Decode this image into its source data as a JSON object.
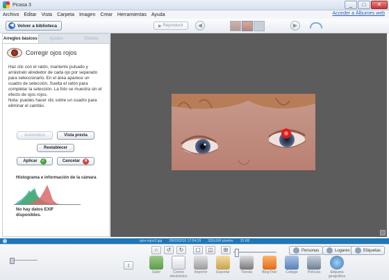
{
  "window": {
    "title": "Picasa 3",
    "controls": [
      "_",
      "□",
      "✕"
    ]
  },
  "menu": {
    "items": [
      "Archivo",
      "Editar",
      "Vista",
      "Carpeta",
      "Imagen",
      "Crear",
      "Herramientas",
      "Ayuda"
    ],
    "sign_in": "Acceder a Álbumes web"
  },
  "toolbar": {
    "back_label": "Volver a biblioteca",
    "play_label": "Reproducir"
  },
  "edit_panel": {
    "tabs": [
      "Arreglos básicos",
      "Ajustes",
      "Efectos"
    ],
    "tool_title": "Corregir ojos rojos",
    "instructions": "Haz clic con el ratón, mantenlo pulsado y arrástralo alrededor de cada ojo por separado para seleccionarlo. En el área aparece un cuadro de selección. Suelta el ratón para completar la selección. La foto se muestra sin el efecto de ojos rojos.",
    "note": "Nota: puedes hacer clic sobre un cuadro para eliminar el cambio.",
    "buttons": {
      "auto": "Automático",
      "preview": "Vista previa",
      "reset": "Restablecer",
      "apply": "Aplicar",
      "cancel": "Cancelar"
    },
    "histogram_title": "Histograma e información de la cámara",
    "no_exif": "No hay datos EXIF disponibles."
  },
  "status": {
    "filename": "ojos-rojos2.jpg",
    "date": "28/03/2010 17:54:29",
    "dimensions": "332x166 píxeles",
    "size": "15 KB"
  },
  "bottom": {
    "tags": [
      "Personas",
      "Lugares",
      "Etiquetas"
    ],
    "actions": [
      "Subir",
      "Correo electrónico",
      "Imprimir",
      "Exportar",
      "Tienda",
      "BlogThis!",
      "Collage",
      "Película",
      "Etiqueta geográfica"
    ]
  },
  "colors": {
    "status_bar": "#1f77b8",
    "canvas": "#5c5c5c",
    "accent": "#3d6cc0"
  }
}
